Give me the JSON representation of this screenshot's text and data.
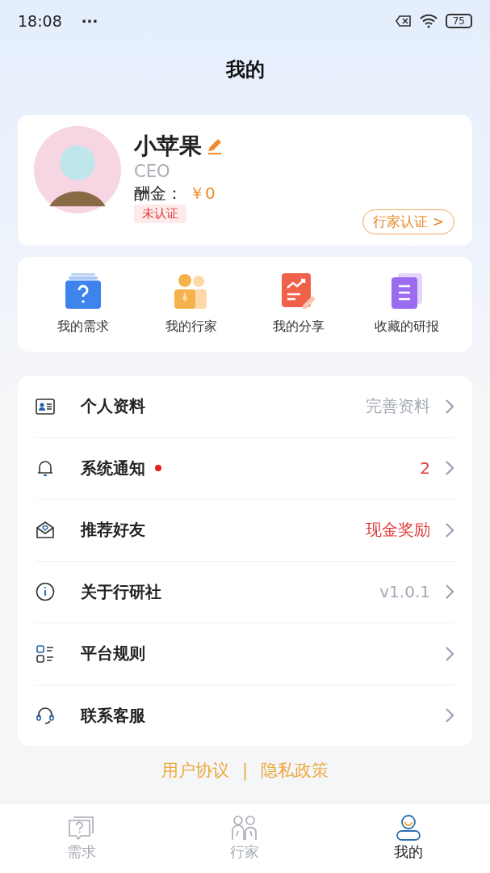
{
  "status_bar": {
    "time": "18:08",
    "more": "···",
    "battery": "75"
  },
  "title": "我的",
  "profile": {
    "name": "小苹果",
    "role": "CEO",
    "reward_label": "酬金：",
    "reward_value": "￥0",
    "verify_status": "未认证",
    "verify_button": "行家认证 >"
  },
  "shortcuts": [
    {
      "label": "我的需求"
    },
    {
      "label": "我的行家"
    },
    {
      "label": "我的分享"
    },
    {
      "label": "收藏的研报"
    }
  ],
  "menu": [
    {
      "label": "个人资料",
      "value": "完善资料",
      "alert": false,
      "dot": false
    },
    {
      "label": "系统通知",
      "value": "2",
      "alert": true,
      "dot": true
    },
    {
      "label": "推荐好友",
      "value": "现金奖励",
      "alert": true,
      "dot": false
    },
    {
      "label": "关于行研社",
      "value": "v1.0.1",
      "alert": false,
      "dot": false
    },
    {
      "label": "平台规则",
      "dot": false
    },
    {
      "label": "联系客服",
      "dot": false
    }
  ],
  "footer": {
    "links": [
      "用户协议",
      "隐私政策"
    ],
    "separator": "|"
  },
  "tabs": [
    {
      "label": "需求",
      "selected": false
    },
    {
      "label": "行家",
      "selected": false
    },
    {
      "label": "我的",
      "selected": true
    }
  ]
}
